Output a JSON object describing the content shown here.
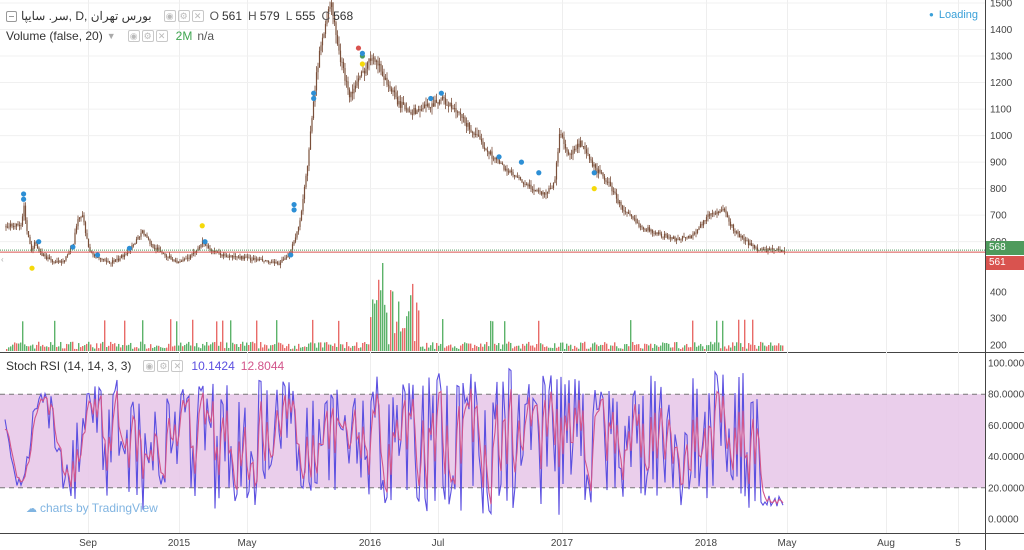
{
  "header": {
    "symbol_title": "سر. سایپا, D, بورس تهران",
    "ohlc": {
      "open_label": "O",
      "open": "561",
      "high_label": "H",
      "high": "579",
      "low_label": "L",
      "low": "555",
      "close_label": "C",
      "close": "568"
    },
    "loading_text": "Loading"
  },
  "volume_legend": {
    "label": "Volume (false, 20)",
    "value": "2M",
    "na": "n/a"
  },
  "stoch_legend": {
    "label": "Stoch RSI (14, 14, 3, 3)",
    "k_value": "10.1424",
    "d_value": "12.8044"
  },
  "watermark": "charts by TradingView",
  "colors": {
    "candle": "#7a4f3a",
    "volume_up": "#3fa650",
    "volume_down": "#e4514f",
    "price_line_close": "#4e9a5c",
    "price_line_open": "#d9534f",
    "k_line": "#5b4fe0",
    "d_line": "#d2548a",
    "band_fill": "#e6c5e8",
    "marker_blue": "#2d8fd5",
    "marker_yellow": "#f5d90a"
  },
  "chart_data": [
    {
      "type": "candlestick",
      "title": "سر. سایپا, D, بورس تهران",
      "y_axis": {
        "ticks": [
          1500,
          1400,
          1300,
          1200,
          1100,
          1000,
          900,
          800,
          700,
          600
        ],
        "range": [
          520,
          1510
        ]
      },
      "x_axis": {
        "ticks": [
          "Sep",
          "2015",
          "May",
          "2016",
          "Jul",
          "2017",
          "2018",
          "May",
          "Aug",
          "5"
        ]
      },
      "price_labels": {
        "close": "568",
        "open": "561"
      },
      "close_series": [
        {
          "x": "2014-08-01",
          "close": 660
        },
        {
          "x": "2014-08-05",
          "close": 740
        },
        {
          "x": "2014-08-10",
          "close": 660
        },
        {
          "x": "2014-08-15",
          "close": 600
        },
        {
          "x": "2014-08-20",
          "close": 565
        },
        {
          "x": "2014-08-25",
          "close": 610
        },
        {
          "x": "2014-09-01",
          "close": 560
        },
        {
          "x": "2014-09-15",
          "close": 540
        },
        {
          "x": "2014-10-01",
          "close": 520
        },
        {
          "x": "2014-10-15",
          "close": 530
        },
        {
          "x": "2014-11-01",
          "close": 580
        },
        {
          "x": "2014-11-10",
          "close": 690
        },
        {
          "x": "2014-11-18",
          "close": 700
        },
        {
          "x": "2014-12-01",
          "close": 560
        },
        {
          "x": "2014-12-15",
          "close": 540
        },
        {
          "x": "2015-01-01",
          "close": 520
        },
        {
          "x": "2015-01-20",
          "close": 530
        },
        {
          "x": "2015-02-10",
          "close": 570
        },
        {
          "x": "2015-03-05",
          "close": 640
        },
        {
          "x": "2015-03-20",
          "close": 590
        },
        {
          "x": "2015-04-15",
          "close": 550
        },
        {
          "x": "2015-05-10",
          "close": 520
        },
        {
          "x": "2015-06-01",
          "close": 545
        },
        {
          "x": "2015-06-20",
          "close": 600
        },
        {
          "x": "2015-07-10",
          "close": 560
        },
        {
          "x": "2015-08-01",
          "close": 545
        },
        {
          "x": "2015-09-01",
          "close": 540
        },
        {
          "x": "2015-10-01",
          "close": 530
        },
        {
          "x": "2015-11-01",
          "close": 515
        },
        {
          "x": "2015-11-20",
          "close": 540
        },
        {
          "x": "2015-12-10",
          "close": 660
        },
        {
          "x": "2015-12-25",
          "close": 880
        },
        {
          "x": "2016-01-05",
          "close": 1150
        },
        {
          "x": "2016-01-15",
          "close": 1300
        },
        {
          "x": "2016-01-25",
          "close": 1420
        },
        {
          "x": "2016-02-05",
          "close": 1500
        },
        {
          "x": "2016-02-20",
          "close": 1300
        },
        {
          "x": "2016-03-10",
          "close": 1150
        },
        {
          "x": "2016-04-05",
          "close": 1250
        },
        {
          "x": "2016-04-20",
          "close": 1310
        },
        {
          "x": "2016-05-10",
          "close": 1220
        },
        {
          "x": "2016-06-05",
          "close": 1120
        },
        {
          "x": "2016-07-01",
          "close": 1090
        },
        {
          "x": "2016-07-25",
          "close": 1110
        },
        {
          "x": "2016-08-20",
          "close": 1140
        },
        {
          "x": "2016-09-20",
          "close": 1080
        },
        {
          "x": "2016-10-20",
          "close": 1000
        },
        {
          "x": "2016-11-20",
          "close": 920
        },
        {
          "x": "2016-12-20",
          "close": 860
        },
        {
          "x": "2017-01-20",
          "close": 810
        },
        {
          "x": "2017-02-20",
          "close": 780
        },
        {
          "x": "2017-03-10",
          "close": 820
        },
        {
          "x": "2017-03-20",
          "close": 1020
        },
        {
          "x": "2017-04-05",
          "close": 920
        },
        {
          "x": "2017-04-25",
          "close": 970
        },
        {
          "x": "2017-05-20",
          "close": 880
        },
        {
          "x": "2017-06-15",
          "close": 820
        },
        {
          "x": "2017-07-10",
          "close": 720
        },
        {
          "x": "2017-08-10",
          "close": 660
        },
        {
          "x": "2017-09-10",
          "close": 630
        },
        {
          "x": "2017-10-10",
          "close": 610
        },
        {
          "x": "2017-11-10",
          "close": 620
        },
        {
          "x": "2017-12-10",
          "close": 700
        },
        {
          "x": "2018-01-05",
          "close": 720
        },
        {
          "x": "2018-01-25",
          "close": 640
        },
        {
          "x": "2018-02-15",
          "close": 600
        },
        {
          "x": "2018-03-05",
          "close": 575
        },
        {
          "x": "2018-03-20",
          "close": 568
        }
      ],
      "markers": [
        {
          "x": "2014-08-05",
          "price": 760,
          "color": "blue"
        },
        {
          "x": "2014-08-05",
          "price": 780,
          "color": "blue"
        },
        {
          "x": "2014-08-20",
          "price": 500,
          "color": "yellow"
        },
        {
          "x": "2014-09-01",
          "price": 600,
          "color": "blue"
        },
        {
          "x": "2014-11-01",
          "price": 580,
          "color": "blue"
        },
        {
          "x": "2014-12-15",
          "price": 550,
          "color": "blue"
        },
        {
          "x": "2015-02-10",
          "price": 575,
          "color": "blue"
        },
        {
          "x": "2015-06-20",
          "price": 660,
          "color": "yellow"
        },
        {
          "x": "2015-06-25",
          "price": 600,
          "color": "blue"
        },
        {
          "x": "2015-11-25",
          "price": 550,
          "color": "blue"
        },
        {
          "x": "2015-12-01",
          "price": 720,
          "color": "blue"
        },
        {
          "x": "2015-12-01",
          "price": 740,
          "color": "blue"
        },
        {
          "x": "2016-01-05",
          "price": 1140,
          "color": "blue"
        },
        {
          "x": "2016-01-05",
          "price": 1160,
          "color": "blue"
        },
        {
          "x": "2016-03-25",
          "price": 1330,
          "color": "red"
        },
        {
          "x": "2016-04-01",
          "price": 1300,
          "color": "green"
        },
        {
          "x": "2016-04-01",
          "price": 1310,
          "color": "blue"
        },
        {
          "x": "2016-04-01",
          "price": 1270,
          "color": "yellow"
        },
        {
          "x": "2016-08-01",
          "price": 1140,
          "color": "blue"
        },
        {
          "x": "2016-08-20",
          "price": 1160,
          "color": "blue"
        },
        {
          "x": "2016-12-01",
          "price": 920,
          "color": "blue"
        },
        {
          "x": "2017-01-10",
          "price": 900,
          "color": "blue"
        },
        {
          "x": "2017-02-10",
          "price": 860,
          "color": "blue"
        },
        {
          "x": "2017-05-20",
          "price": 860,
          "color": "blue"
        },
        {
          "x": "2017-05-20",
          "price": 800,
          "color": "yellow"
        }
      ]
    },
    {
      "type": "bar",
      "title": "Volume (false, 20)",
      "y_axis": {
        "ticks": [
          400,
          300,
          200
        ],
        "unit_note": "2M"
      },
      "values_note": "daily volume bars, green = up day, red = down day; spike around 2016 with values near 500"
    },
    {
      "type": "line",
      "title": "Stoch RSI (14, 14, 3, 3)",
      "y_axis": {
        "ticks": [
          "100.0000",
          "80.0000",
          "60.0000",
          "40.0000",
          "20.0000",
          "0.0000"
        ],
        "range": [
          0,
          100
        ]
      },
      "bands": {
        "upper": 80,
        "lower": 20
      },
      "series": [
        {
          "name": "K",
          "last": 10.1424
        },
        {
          "name": "D",
          "last": 12.8044
        }
      ]
    }
  ]
}
